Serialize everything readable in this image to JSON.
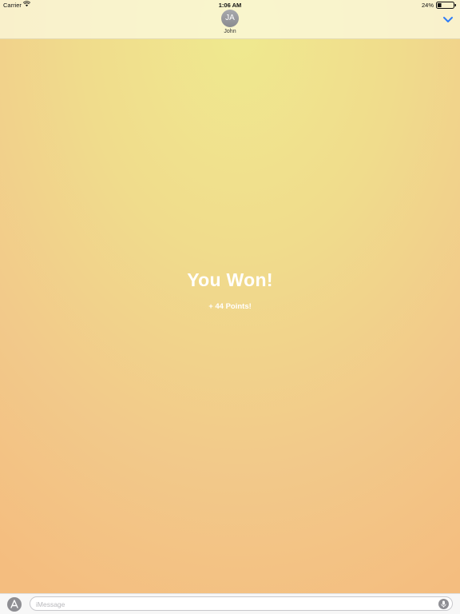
{
  "status_bar": {
    "carrier": "Carrier",
    "time": "1:06 AM",
    "battery_percent": "24%",
    "battery_level": 0.24
  },
  "header": {
    "avatar_initials": "JA",
    "contact_name": "John",
    "collapse_icon": "chevron-down-icon",
    "accent_color": "#2f7cf6"
  },
  "game": {
    "result_title": "You Won!",
    "points_text": "+ 44 Points!"
  },
  "compose": {
    "placeholder": "iMessage",
    "app_icon": "app-store-icon",
    "mic_icon": "microphone-icon"
  }
}
